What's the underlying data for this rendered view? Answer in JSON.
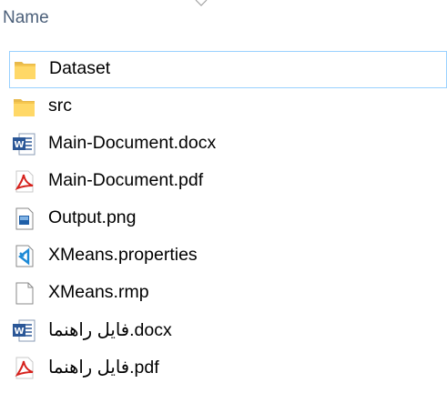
{
  "window": {
    "column_header": {
      "name_label": "Name"
    }
  },
  "files": [
    {
      "name": "Dataset",
      "icon": "folder-icon",
      "selected": true
    },
    {
      "name": "src",
      "icon": "folder-icon",
      "selected": false
    },
    {
      "name": "Main-Document.docx",
      "icon": "word-document-icon",
      "selected": false
    },
    {
      "name": "Main-Document.pdf",
      "icon": "pdf-file-icon",
      "selected": false
    },
    {
      "name": "Output.png",
      "icon": "image-file-icon",
      "selected": false
    },
    {
      "name": "XMeans.properties",
      "icon": "vscode-file-icon",
      "selected": false
    },
    {
      "name": "XMeans.rmp",
      "icon": "blank-file-icon",
      "selected": false
    },
    {
      "name_rtl": "فایل راهنما",
      "name_ext": ".docx",
      "icon": "word-document-icon",
      "selected": false
    },
    {
      "name_rtl": "فایل راهنما",
      "name_ext": ".pdf",
      "icon": "pdf-file-icon",
      "selected": false
    }
  ],
  "colors": {
    "header_text": "#4c607a",
    "selection_border": "#99d1ff",
    "folder": "#ffd867",
    "word_blue": "#2b5797",
    "pdf_red": "#d6211c",
    "vscode_blue": "#1e8ad6"
  }
}
